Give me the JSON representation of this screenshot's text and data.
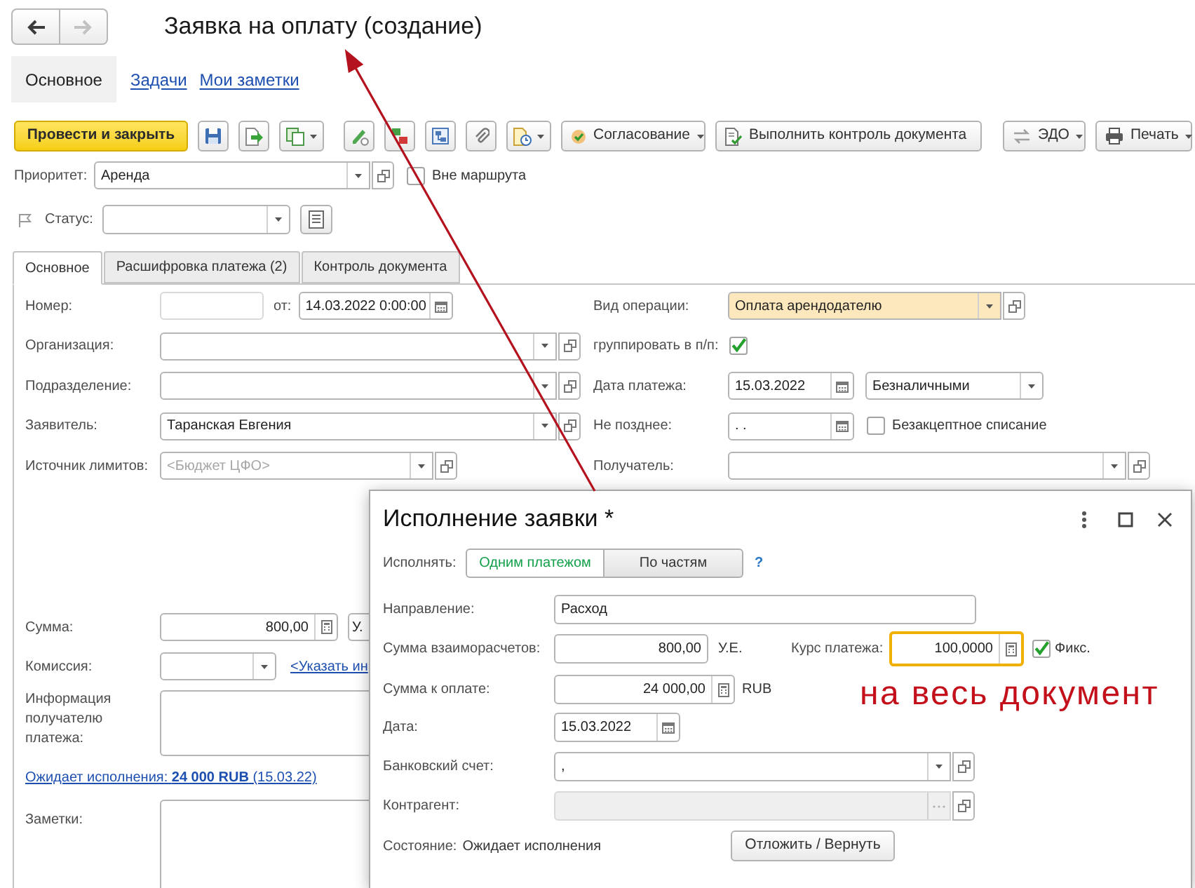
{
  "back_button": {
    "disabled": false
  },
  "forward_button": {
    "disabled": true
  },
  "window": {
    "title": "Заявка на оплату (создание)"
  },
  "section_tabs": [
    {
      "label": "Основное",
      "selected": true
    },
    {
      "label": "Задачи",
      "selected": false
    },
    {
      "label": "Мои заметки",
      "selected": false
    }
  ],
  "toolbar": {
    "buttons": [
      "Провести и закрыть",
      "Согласование",
      "Выполнить контроль документа",
      "ЭДО",
      "Печать"
    ]
  },
  "priority": {
    "label": "Приоритет:",
    "value": "Аренда"
  },
  "off_route": {
    "label": "Вне маршрута",
    "checked": false
  },
  "status": {
    "label": "Статус:"
  },
  "form_tabs": [
    {
      "label": "Основное",
      "selected": true
    },
    {
      "label": "Расшифровка платежа (2)",
      "selected": false
    },
    {
      "label": "Контроль документа",
      "selected": false
    }
  ],
  "main": {
    "number": {
      "label": "Номер:"
    },
    "date": {
      "label": "от:",
      "value": "14.03.2022 0:00:00"
    },
    "organization": {
      "label": "Организация:"
    },
    "department": {
      "label": "Подразделение:"
    },
    "applicant": {
      "label": "Заявитель:",
      "value": "Таранская Евгения"
    },
    "limit_source": {
      "label": "Источник лимитов:",
      "placeholder": "<Бюджет ЦФО>"
    },
    "operation_type": {
      "label": "Вид операции:",
      "value": "Оплата арендодателю",
      "highlighted": true
    },
    "group_in_payment_order": {
      "label": "группировать в п/п:",
      "checked": true
    },
    "payment_date": {
      "label": "Дата платежа:",
      "value": "15.03.2022"
    },
    "payment_form": {
      "value": "Безналичными"
    },
    "not_later_than": {
      "label": "Не позднее:",
      "value": ". ."
    },
    "direct_debit": {
      "label": "Безакцептное списание",
      "checked": false
    },
    "recipient": {
      "label": "Получатель:"
    },
    "amount": {
      "label": "Сумма:",
      "value": "800,00",
      "currency": "У."
    },
    "commission": {
      "label": "Комиссия:",
      "link": "<Указать ин"
    },
    "recipient_info": {
      "label": "Информация получателю платежа:"
    },
    "execution_link": "Ожидает исполнения: **24 000 RUB** (15.03.22)",
    "notes": {
      "label": "Заметки:"
    }
  },
  "dialog": {
    "title": "Исполнение заявки *",
    "execute": {
      "label": "Исполнять:",
      "options": [
        {
          "label": "Одним платежом",
          "selected": true
        },
        {
          "label": "По частям",
          "selected": false
        }
      ],
      "help": "?"
    },
    "direction": {
      "label": "Направление:",
      "value": "Расход"
    },
    "settlement_amount": {
      "label": "Сумма взаиморасчетов:",
      "value": "800,00",
      "currency": "У.Е."
    },
    "payment_rate": {
      "label": "Курс платежа:",
      "value": "100,0000",
      "focused": true
    },
    "fixed": {
      "label": "Фикс.",
      "checked": true
    },
    "amount_to_pay": {
      "label": "Сумма к оплате:",
      "value": "24 000,00",
      "currency": "RUB"
    },
    "date": {
      "label": "Дата:",
      "value": "15.03.2022"
    },
    "bank_account": {
      "label": "Банковский счет:",
      "value": ","
    },
    "counterparty": {
      "label": "Контрагент:",
      "disabled": true
    },
    "state": {
      "label": "Состояние:",
      "value": "Ожидает исполнения"
    },
    "button": "Отложить / Вернуть"
  },
  "annotation": {
    "text": "на весь документ"
  }
}
